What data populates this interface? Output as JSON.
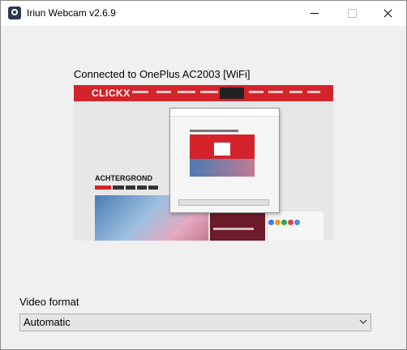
{
  "window": {
    "title": "Iriun Webcam v2.6.9"
  },
  "main": {
    "status_text": "Connected to OnePlus AC2003 [WiFi]"
  },
  "preview": {
    "logo_text": "CLICKX",
    "heading_text": "ACHTERGROND"
  },
  "format": {
    "label": "Video format",
    "selected": "Automatic"
  },
  "icons": {
    "app": "webcam-app-icon",
    "minimize": "minimize-icon",
    "maximize": "maximize-icon",
    "close": "close-icon",
    "dropdown": "chevron-down-icon"
  }
}
